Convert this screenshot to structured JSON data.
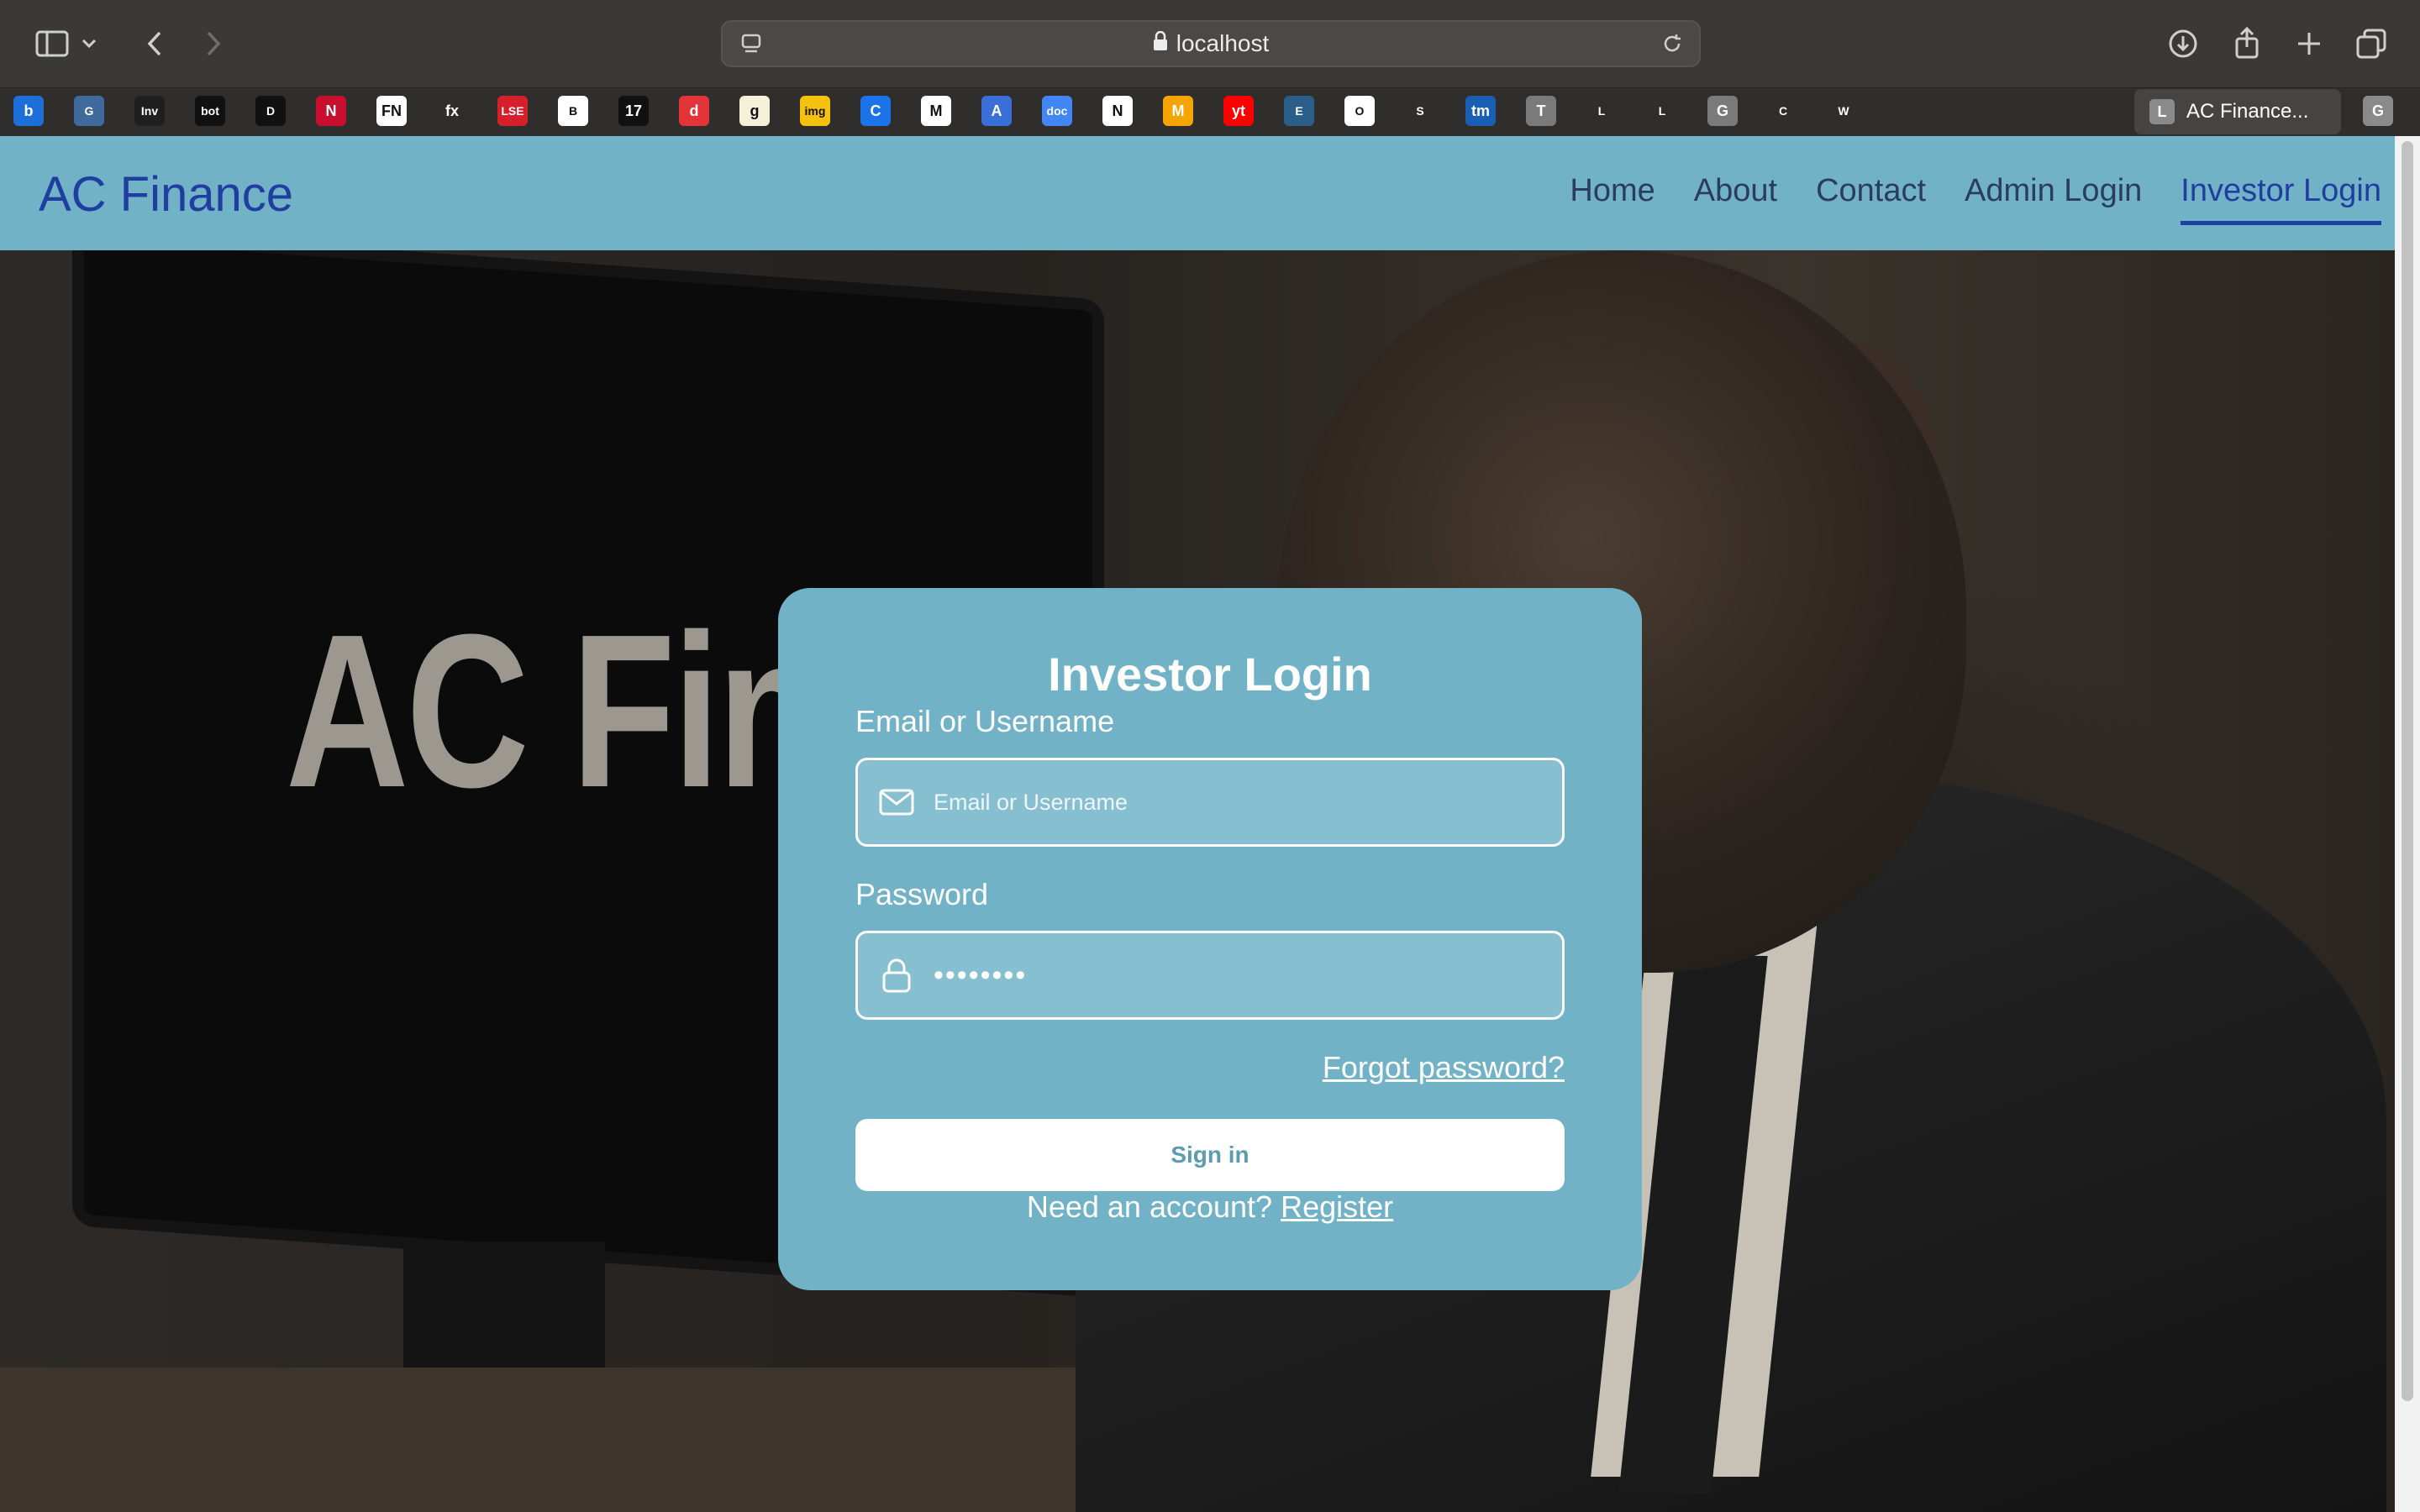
{
  "browser": {
    "url": "localhost",
    "active_tab_title": "AC Finance...",
    "active_tab_favicon": "L",
    "extra_tab_favicon": "G",
    "favorites": [
      {
        "icon": "b",
        "color": "#1c6fd8"
      },
      {
        "icon": "globe",
        "color": "#3f6a9b"
      },
      {
        "icon": "Inv",
        "color": "#1f1f1f"
      },
      {
        "icon": "bot",
        "color": "#111111"
      },
      {
        "icon": "diamond",
        "color": "#111111"
      },
      {
        "icon": "N",
        "color": "#c8102e"
      },
      {
        "icon": "FN",
        "color": "#ffffff"
      },
      {
        "icon": "fx",
        "color": "#2f2e2c"
      },
      {
        "icon": "LSE",
        "color": "#d5202c"
      },
      {
        "icon": "bird",
        "color": "#ffffff"
      },
      {
        "icon": "17",
        "color": "#111111"
      },
      {
        "icon": "d",
        "color": "#e3343a"
      },
      {
        "icon": "g",
        "color": "#f5f0d8"
      },
      {
        "icon": "img",
        "color": "#f4c20d"
      },
      {
        "icon": "C",
        "color": "#1a73e8"
      },
      {
        "icon": "M",
        "color": "#ffffff"
      },
      {
        "icon": "A",
        "color": "#3a6fd8"
      },
      {
        "icon": "doc",
        "color": "#4285f4"
      },
      {
        "icon": "N",
        "color": "#ffffff"
      },
      {
        "icon": "M",
        "color": "#f5a400"
      },
      {
        "icon": "yt",
        "color": "#ff0000"
      },
      {
        "icon": "earth",
        "color": "#2b5f8a"
      },
      {
        "icon": "openai",
        "color": "#ffffff"
      },
      {
        "icon": "star",
        "color": "#2f2e2c"
      },
      {
        "icon": "tm",
        "color": "#1a5fb4"
      },
      {
        "icon": "T",
        "color": "#7a7a7a"
      },
      {
        "icon": "leaf",
        "color": "#2f2e2c"
      },
      {
        "icon": "leaf",
        "color": "#2f2e2c"
      },
      {
        "icon": "G",
        "color": "#7a7a7a"
      },
      {
        "icon": "compass",
        "color": "#2f2e2c"
      },
      {
        "icon": "wave",
        "color": "#2f2e2c"
      }
    ]
  },
  "navbar": {
    "brand": "AC Finance",
    "links": [
      "Home",
      "About",
      "Contact",
      "Admin Login",
      "Investor Login"
    ],
    "active": "Investor Login"
  },
  "hero": {
    "monitor_text": "AC Fina"
  },
  "login": {
    "title": "Investor Login",
    "email_label": "Email or Username",
    "email_placeholder": "Email or Username",
    "password_label": "Password",
    "password_value": "••••••••",
    "forgot": "Forgot password?",
    "submit": "Sign in",
    "register_prompt": "Need an account?",
    "register_link": "Register"
  },
  "colors": {
    "navbar_bg": "#72b2c6",
    "brand": "#1e3fa0",
    "card_bg": "#72b2c6"
  }
}
